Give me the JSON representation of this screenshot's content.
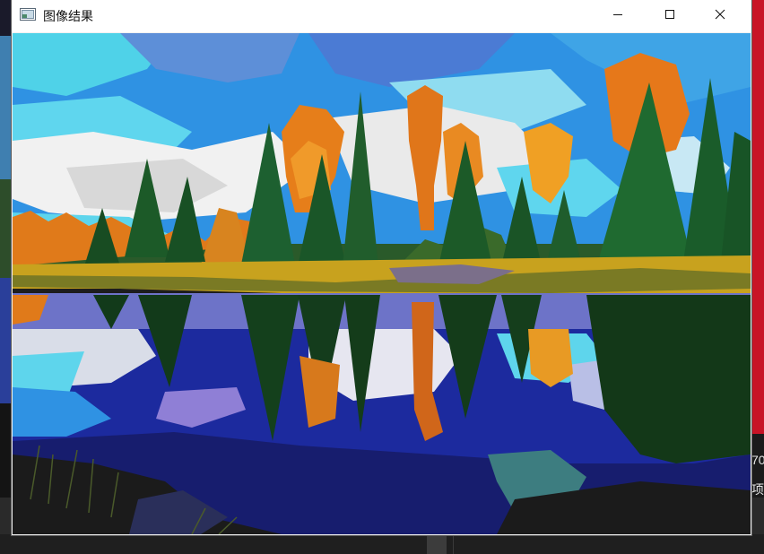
{
  "window": {
    "title": "图像结果",
    "controls": [
      "minimize",
      "maximize",
      "close"
    ],
    "app_icon": "image-window-icon"
  },
  "image": {
    "description_icon": "posterized-landscape-image"
  },
  "background": {
    "right_text_1": "70",
    "right_text_2": "项",
    "accent_color": "#c81426"
  },
  "colors": {
    "titlebar": "#ffffff",
    "sky": "#2d8fe0",
    "water_deep": "#1a2a9a",
    "foliage_orange": "#e07a1a",
    "pine": "#1d5a2a"
  }
}
